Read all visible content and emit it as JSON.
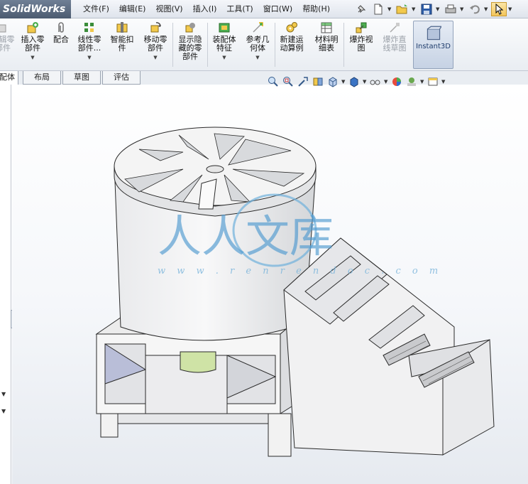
{
  "app": {
    "logo": "SolidWorks"
  },
  "menu": [
    "文件(F)",
    "编辑(E)",
    "视图(V)",
    "插入(I)",
    "工具(T)",
    "窗口(W)",
    "帮助(H)"
  ],
  "quick_access": {
    "icons": [
      "pushpin-icon",
      "new-document-icon",
      "open-folder-icon",
      "save-icon",
      "print-icon",
      "undo-icon",
      "select-arrow-icon"
    ]
  },
  "ribbon": {
    "edit_component": "编辑零\n部件",
    "insert_component": "插入零\n部件",
    "mate": "配合",
    "linear_pattern": "线性零\n部件...",
    "smart_fasteners": "智能扣\n件",
    "move_component": "移动零\n部件",
    "show_hidden": "显示隐\n藏的零\n部件",
    "assembly_features": "装配体\n特征",
    "reference_geometry": "参考几\n何体",
    "new_motion_study": "新建运\n动算例",
    "bom": "材料明\n细表",
    "exploded_view": "爆炸视\n图",
    "explode_line_sketch": "爆炸直\n线草图",
    "instant3d": "Instant3D"
  },
  "tabs": [
    "配体",
    "布局",
    "草图",
    "评估"
  ],
  "active_tab": 0,
  "viewport": {
    "watermark": "人人文库",
    "watermark_url": "w w w . r e n r e n d o c . c o m",
    "toolbar_icons": [
      "zoom-to-fit-icon",
      "zoom-area-icon",
      "previous-view-icon",
      "section-view-icon",
      "view-orientation-icon",
      "display-style-icon",
      "hide-show-icon",
      "appearance-icon",
      "scene-icon",
      "view-settings-icon"
    ]
  },
  "colors": {
    "model_face": "#f2f2f2",
    "model_shade": "#d6d8db",
    "model_edge": "#2a2a2a",
    "motor": "#cfe3a6",
    "watermark": "#4f9ad0",
    "viewport_top": "#ffffff",
    "viewport_bottom": "#e6eaf0"
  }
}
